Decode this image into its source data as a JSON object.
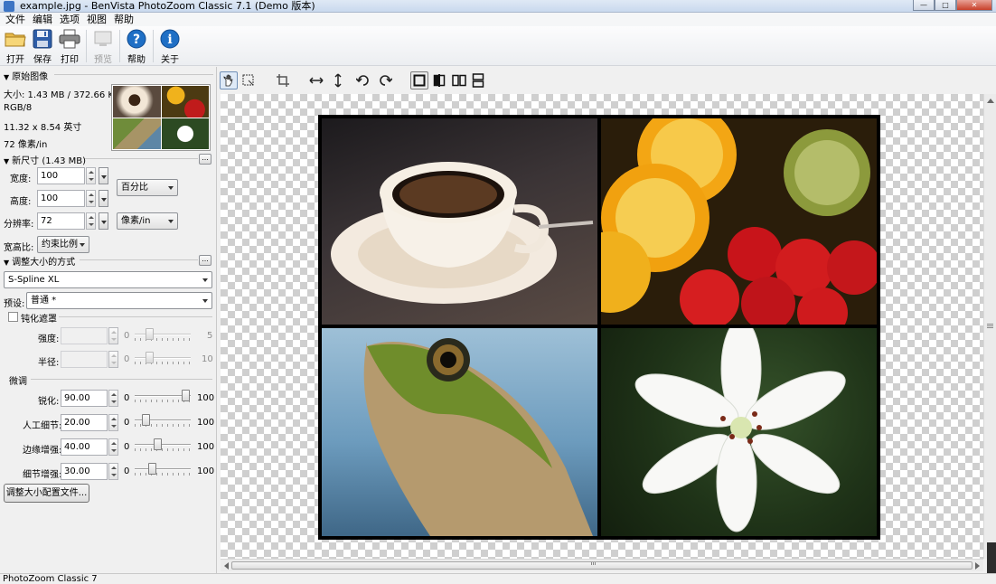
{
  "window": {
    "title": "example.jpg - BenVista PhotoZoom Classic 7.1 (Demo 版本)",
    "minimize": "—",
    "maximize": "□",
    "close": "✕"
  },
  "menu": [
    "文件",
    "编辑",
    "选项",
    "视图",
    "帮助"
  ],
  "toolbar": {
    "open": "打开",
    "save": "保存",
    "print": "打印",
    "preview": "预览",
    "help": "帮助",
    "about": "关于"
  },
  "original": {
    "header": "原始图像",
    "size": "大小: 1.43 MB / 372.66 KB",
    "mode": "RGB/8",
    "dimensions": "11.32 x 8.54 英寸",
    "resolution": "72 像素/in"
  },
  "newsize": {
    "header": "新尺寸 (1.43 MB)",
    "width_label": "宽度:",
    "width_value": "100",
    "height_label": "高度:",
    "height_value": "100",
    "unit": "百分比",
    "resolution_label": "分辨率:",
    "resolution_value": "72",
    "resolution_unit": "像素/in",
    "aspect_label": "宽高比:",
    "aspect_value": "约束比例"
  },
  "method": {
    "header": "调整大小的方式",
    "algorithm": "S-Spline XL",
    "preset_label": "预设:",
    "preset_value": "普通 *"
  },
  "unsharp": {
    "label": "钝化遮罩",
    "strength_label": "强度:",
    "strength_min": "0",
    "strength_max": "5",
    "radius_label": "半径:",
    "radius_min": "0",
    "radius_max": "10"
  },
  "finetune": {
    "label": "微调",
    "rows": [
      {
        "label": "锐化:",
        "value": "90.00",
        "min": "0",
        "max": "100",
        "level": 90
      },
      {
        "label": "人工细节:",
        "value": "20.00",
        "min": "0",
        "max": "100",
        "level": 20
      },
      {
        "label": "边缘增强:",
        "value": "40.00",
        "min": "0",
        "max": "100",
        "level": 40
      },
      {
        "label": "细节增强:",
        "value": "30.00",
        "min": "0",
        "max": "100",
        "level": 30
      }
    ],
    "profile_button": "调整大小配置文件..."
  },
  "statusbar": "PhotoZoom Classic 7",
  "colors": {
    "accent": "#1f6fc5",
    "checker": "#cfcfcf"
  }
}
